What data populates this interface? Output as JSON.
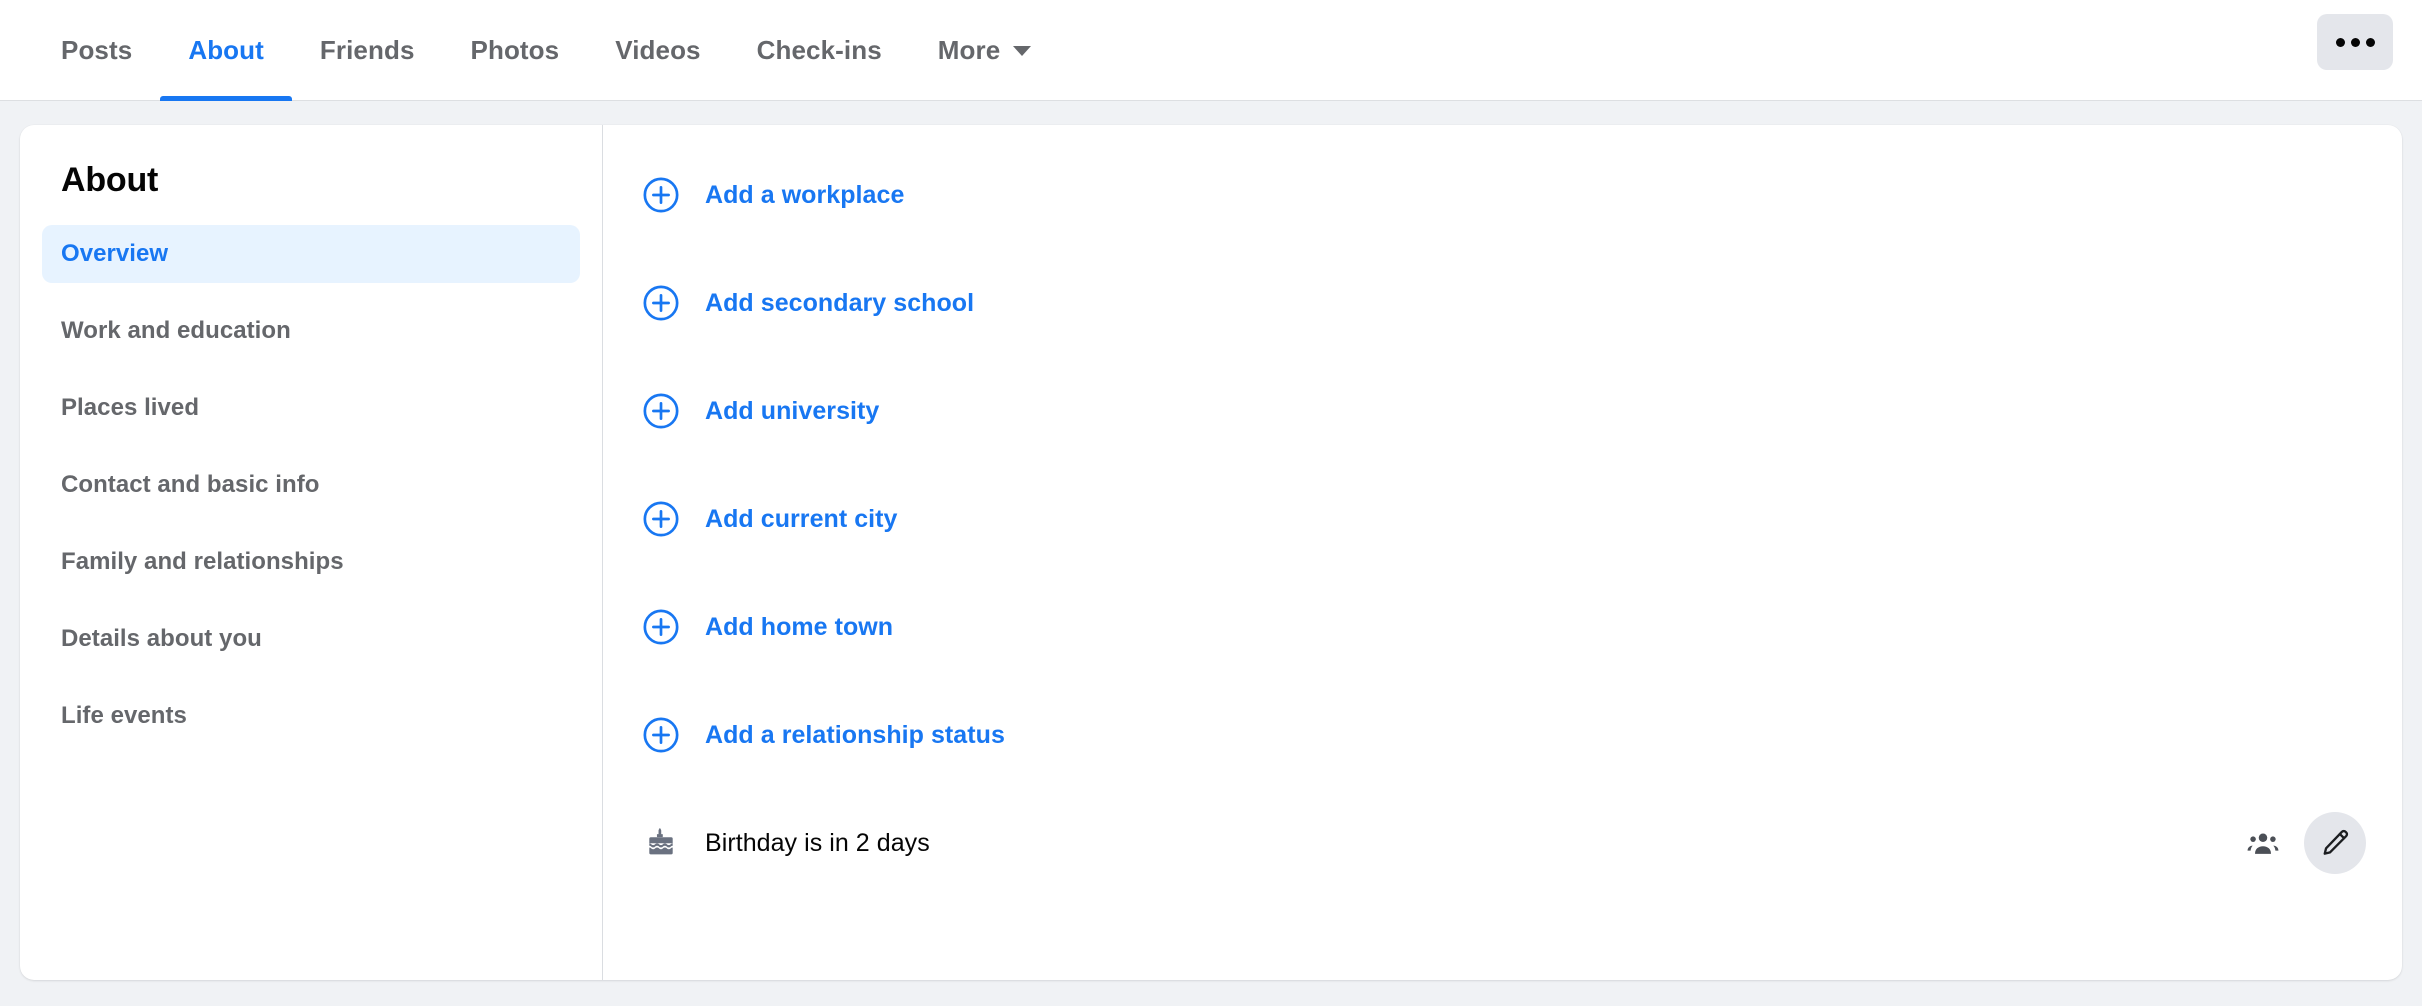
{
  "topbar": {
    "tabs": [
      {
        "label": "Posts",
        "active": false
      },
      {
        "label": "About",
        "active": true
      },
      {
        "label": "Friends",
        "active": false
      },
      {
        "label": "Photos",
        "active": false
      },
      {
        "label": "Videos",
        "active": false
      },
      {
        "label": "Check-ins",
        "active": false
      },
      {
        "label": "More",
        "active": false,
        "caret": true
      }
    ],
    "more_options_label": "..."
  },
  "about": {
    "title": "About",
    "nav_items": [
      {
        "label": "Overview",
        "active": true
      },
      {
        "label": "Work and education",
        "active": false
      },
      {
        "label": "Places lived",
        "active": false
      },
      {
        "label": "Contact and basic info",
        "active": false
      },
      {
        "label": "Family and relationships",
        "active": false
      },
      {
        "label": "Details about you",
        "active": false
      },
      {
        "label": "Life events",
        "active": false
      }
    ]
  },
  "overview": {
    "add_rows": [
      {
        "label": "Add a workplace",
        "icon": "plus-circle-icon"
      },
      {
        "label": "Add secondary school",
        "icon": "plus-circle-icon"
      },
      {
        "label": "Add university",
        "icon": "plus-circle-icon"
      },
      {
        "label": "Add current city",
        "icon": "plus-circle-icon"
      },
      {
        "label": "Add home town",
        "icon": "plus-circle-icon"
      },
      {
        "label": "Add a relationship status",
        "icon": "plus-circle-icon"
      }
    ],
    "birthday_row": {
      "label": "Birthday is in 2 days",
      "icon": "birthday-cake-icon",
      "audience_icon": "friends-group-icon",
      "edit_icon": "pencil-icon"
    }
  },
  "colors": {
    "accent": "#1877f2",
    "accent_bg": "#e7f3ff",
    "page_bg": "#f0f2f5",
    "card_bg": "#ffffff",
    "text_primary": "#050505",
    "text_secondary": "#65676b",
    "chip_bg": "#e4e6eb",
    "icon_gray": "#65676b"
  }
}
